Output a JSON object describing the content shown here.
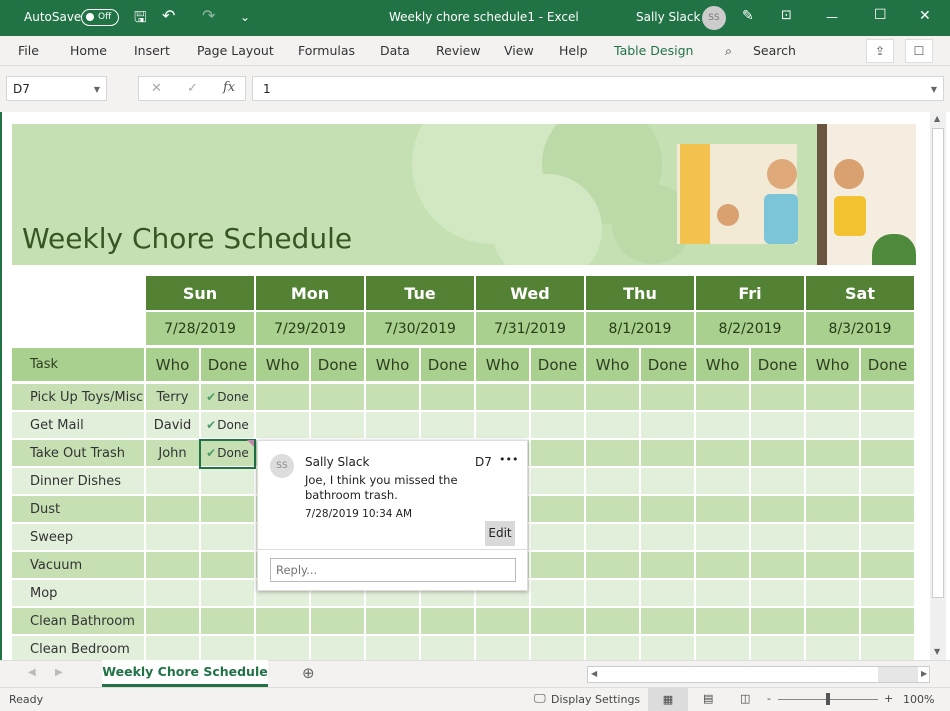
{
  "titlebar": {
    "autosave_label": "AutoSave",
    "autosave_state": "Off",
    "title": "Weekly chore schedule1  -  Excel",
    "user": "Sally Slack",
    "user_initials": "SS"
  },
  "ribbon": {
    "tabs": [
      "File",
      "Home",
      "Insert",
      "Page Layout",
      "Formulas",
      "Data",
      "Review",
      "View",
      "Help",
      "Table Design"
    ],
    "search": "Search"
  },
  "formula_bar": {
    "name_box": "D7",
    "value": "1"
  },
  "sheet": {
    "title": "Weekly Chore Schedule",
    "days": [
      {
        "name": "Sun",
        "date": "7/28/2019"
      },
      {
        "name": "Mon",
        "date": "7/29/2019"
      },
      {
        "name": "Tue",
        "date": "7/30/2019"
      },
      {
        "name": "Wed",
        "date": "7/31/2019"
      },
      {
        "name": "Thu",
        "date": "8/1/2019"
      },
      {
        "name": "Fri",
        "date": "8/2/2019"
      },
      {
        "name": "Sat",
        "date": "8/3/2019"
      }
    ],
    "task_header": "Task",
    "who_header": "Who",
    "done_header": "Done",
    "tasks": [
      {
        "task": "Pick Up Toys/Misc",
        "who": "Terry",
        "done": "Done"
      },
      {
        "task": "Get Mail",
        "who": "David",
        "done": "Done"
      },
      {
        "task": "Take Out Trash",
        "who": "John",
        "done": "Done"
      },
      {
        "task": "Dinner Dishes",
        "who": "",
        "done": ""
      },
      {
        "task": "Dust",
        "who": "",
        "done": ""
      },
      {
        "task": "Sweep",
        "who": "",
        "done": ""
      },
      {
        "task": "Vacuum",
        "who": "",
        "done": ""
      },
      {
        "task": "Mop",
        "who": "",
        "done": ""
      },
      {
        "task": "Clean Bathroom",
        "who": "",
        "done": ""
      },
      {
        "task": "Clean Bedroom",
        "who": "",
        "done": ""
      }
    ]
  },
  "comment": {
    "initials": "SS",
    "author": "Sally Slack",
    "cell": "D7",
    "more": "•••",
    "text": "Joe, I think you missed the bathroom trash.",
    "timestamp": "7/28/2019 10:34 AM",
    "edit": "Edit",
    "reply_placeholder": "Reply..."
  },
  "sheet_tabs": {
    "active": "Weekly Chore Schedule"
  },
  "status": {
    "ready": "Ready",
    "display_settings": "Display Settings",
    "zoom": "100%",
    "zoom_level_percent": 100
  },
  "colors": {
    "brand": "#217346",
    "day_header": "#548235",
    "header_light": "#a9d08e",
    "row_a": "#c6e0b4",
    "row_b": "#e2efda"
  }
}
